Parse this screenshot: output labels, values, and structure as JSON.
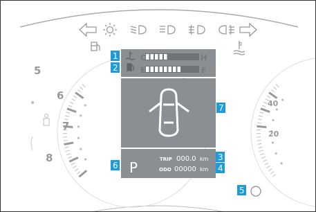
{
  "callouts": [
    "1",
    "2",
    "3",
    "4",
    "5",
    "6",
    "7"
  ],
  "temp_gauge": {
    "low": "C",
    "high": "H"
  },
  "fuel_gauge": {
    "low": "E",
    "high": "F"
  },
  "display": {
    "gear": "P",
    "trip_label": "TRIP",
    "trip_value": "000.0",
    "trip_unit": "km",
    "odo_label": "ODO",
    "odo_value": "00000",
    "odo_unit": "km"
  },
  "tachometer": {
    "labels": [
      "5",
      "6",
      "7",
      "8"
    ]
  },
  "speedometer": {
    "labels": [
      "40",
      "20"
    ]
  },
  "colors": {
    "accent": "#1e9bdc",
    "display_bg": "#8a8f94",
    "display_dark": "#5f6569",
    "gauge_dark": "#777777"
  }
}
